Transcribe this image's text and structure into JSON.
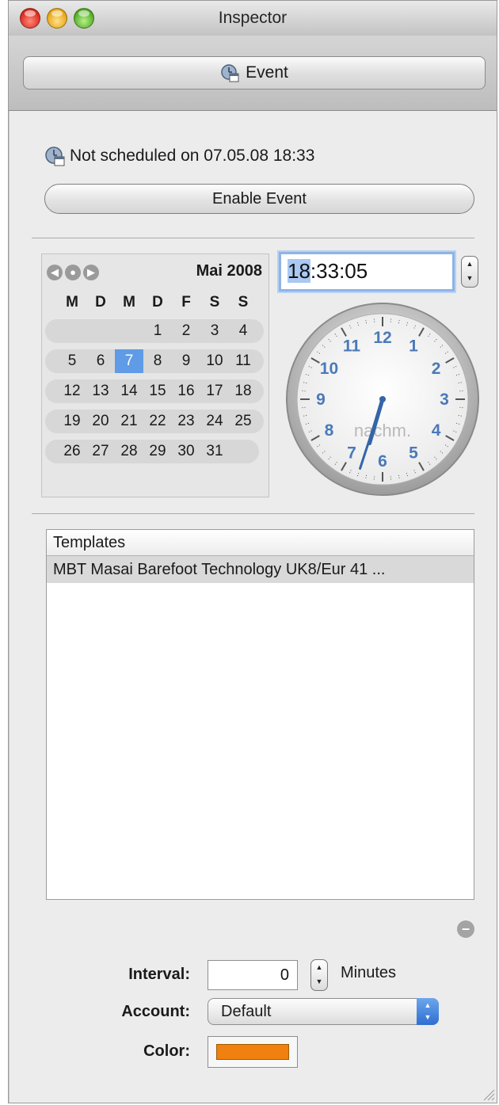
{
  "window": {
    "title": "Inspector"
  },
  "toolbar": {
    "event_button_label": "Event"
  },
  "status": {
    "text": "Not scheduled on 07.05.08 18:33"
  },
  "enable_button": {
    "label": "Enable Event"
  },
  "calendar": {
    "month_label": "Mai 2008",
    "weekday_headers": [
      "M",
      "D",
      "M",
      "D",
      "F",
      "S",
      "S"
    ],
    "weeks": [
      [
        "",
        "",
        "",
        "1",
        "2",
        "3",
        "4"
      ],
      [
        "5",
        "6",
        "7",
        "8",
        "9",
        "10",
        "11"
      ],
      [
        "12",
        "13",
        "14",
        "15",
        "16",
        "17",
        "18"
      ],
      [
        "19",
        "20",
        "21",
        "22",
        "23",
        "24",
        "25"
      ],
      [
        "26",
        "27",
        "28",
        "29",
        "30",
        "31",
        ""
      ]
    ],
    "selected_day": "7"
  },
  "time": {
    "hours": "18",
    "rest": ":33:05"
  },
  "clock": {
    "numbers": [
      "12",
      "1",
      "2",
      "3",
      "4",
      "5",
      "6",
      "7",
      "8",
      "9",
      "10",
      "11"
    ],
    "period_label": "nachm.",
    "hour": 18,
    "minute": 33,
    "second": 5
  },
  "templates": {
    "header": "Templates",
    "rows": [
      "MBT Masai Barefoot Technology UK8/Eur 41 ..."
    ]
  },
  "form": {
    "interval_label": "Interval:",
    "interval_value": "0",
    "interval_unit": "Minutes",
    "account_label": "Account:",
    "account_value": "Default",
    "color_label": "Color:",
    "color_value": "#f08010"
  },
  "colors": {
    "accent_blue": "#5f9be6",
    "clock_numbers": "#4a79b8"
  }
}
